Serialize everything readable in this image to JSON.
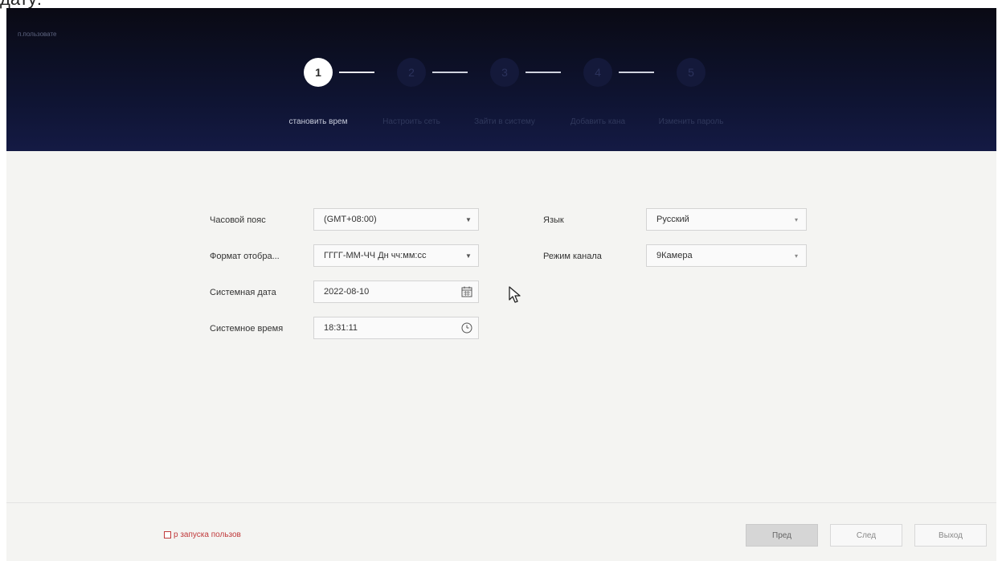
{
  "caption": "дату:",
  "header": {
    "user_label": "п.пользовате",
    "steps": [
      {
        "number": "1",
        "label": "становить врем",
        "active": true
      },
      {
        "number": "2",
        "label": "Настроить сеть",
        "active": false
      },
      {
        "number": "3",
        "label": "Зайти в систему",
        "active": false
      },
      {
        "number": "4",
        "label": "Добавить кана",
        "active": false
      },
      {
        "number": "5",
        "label": "Изменить пароль",
        "active": false
      }
    ]
  },
  "form": {
    "timezone": {
      "label": "Часовой пояс",
      "value": "(GMT+08:00)"
    },
    "format": {
      "label": "Формат отобра...",
      "value": "ГГГГ-ММ-ЧЧ Дн чч:мм:сс"
    },
    "date": {
      "label": "Системная дата",
      "value": "2022-08-10"
    },
    "time": {
      "label": "Системное время",
      "value": "18:31:11"
    },
    "language": {
      "label": "Язык",
      "value": "Русский"
    },
    "channel_mode": {
      "label": "Режим канала",
      "value": "9Камера"
    }
  },
  "footer": {
    "autostart_label": "р запуска пользов",
    "prev": "Пред",
    "next": "След",
    "exit": "Выход"
  },
  "icons": {
    "dropdown": "chevron-down-icon",
    "calendar": "calendar-icon",
    "clock": "clock-icon",
    "cursor": "mouse-pointer-icon"
  },
  "colors": {
    "header_bg": "#0e1330",
    "page_bg": "#f4f4f2",
    "active_step": "#ffffff",
    "autostart_text": "#c0393b"
  }
}
